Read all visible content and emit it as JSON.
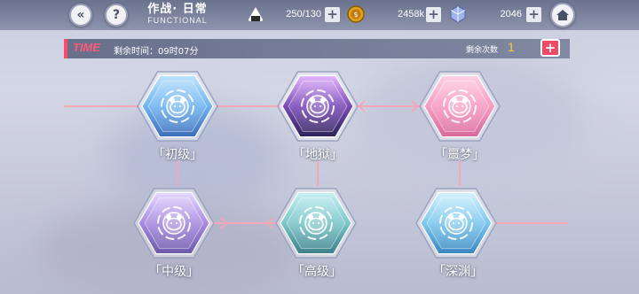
{
  "header": {
    "title": "作战· 日常",
    "subtitle": "FUNCTIONAL",
    "back_icon": "double-chevron-left-icon",
    "help_icon": "question-mark-icon",
    "home_icon": "home-icon"
  },
  "resources": [
    {
      "name": "stamina",
      "icon": "rice-ball-icon",
      "value": "250/130"
    },
    {
      "name": "coin",
      "icon": "coin-icon",
      "value": "2458k"
    },
    {
      "name": "crystal",
      "icon": "cube-crystal-icon",
      "value": "2046"
    }
  ],
  "time_bar": {
    "label": "TIME",
    "remaining_time": "剩余时间：09时07分",
    "remaining_count_label": "剩余次数",
    "remaining_count": "1",
    "add_label": "+"
  },
  "levels": [
    {
      "label": "「初级」",
      "theme": "blue"
    },
    {
      "label": "「地狱」",
      "theme": "purple"
    },
    {
      "label": "「噩梦」",
      "theme": "pink"
    },
    {
      "label": "「中级」",
      "theme": "lavender"
    },
    {
      "label": "「高级」",
      "theme": "teal"
    },
    {
      "label": "「深渊」",
      "theme": "cyan"
    }
  ],
  "colors": {
    "accent": "#ff4a6a",
    "count": "#ffcc33",
    "connector": "#f7a6b8"
  }
}
